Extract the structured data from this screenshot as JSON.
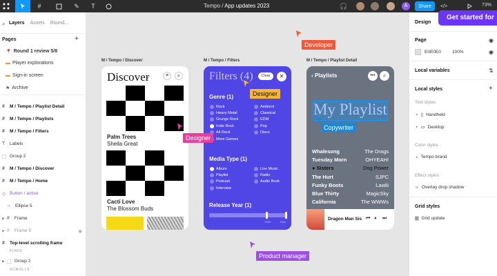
{
  "toolbar": {
    "file_path": "Tempo",
    "separator": "/",
    "file_name": "App updates 2023",
    "share_label": "Share",
    "avatar_letter": "A",
    "zoom": "73%",
    "code_label": "</>"
  },
  "promo": {
    "label": "Get started for"
  },
  "left_panel": {
    "tabs": [
      "Layers",
      "Assets",
      "Round..."
    ],
    "pages_title": "Pages",
    "pages": [
      "Round 1 review 5/8",
      "Player explorations",
      "Sign-in screen",
      "Archive"
    ],
    "layers": [
      "M / Tempo / Playlist Detail",
      "M / Tempo / Playlists",
      "M / Tempo / Filters",
      "Labels",
      "Group 2",
      "M / Tempo / Discover",
      "M / Tempo / Home",
      "Button / active",
      "Ellipse 5",
      "Frame",
      "Frame 5",
      "Top-level scrolling frame",
      "Group 2"
    ],
    "fixed_label": "FIXED",
    "scrolls_label": "SCROLLS"
  },
  "frames": {
    "discover": {
      "label": "M / Tempo / Discover",
      "title": "Discover",
      "track1_title": "Palm Trees",
      "track1_artist": "Sheila Great",
      "track2_title": "Cacti Love",
      "track2_artist": "The Blossom Buds"
    },
    "filters": {
      "label": "M / Tempo / Filters",
      "title": "Filters (4)",
      "clear": "Clear",
      "genre_title": "Genre (1)",
      "genres_left": [
        "Rock",
        "Heavy Metal",
        "Grunge Rock",
        "Indie Rock",
        "Alt Rock",
        "More Genres"
      ],
      "genres_right": [
        "Ambient",
        "Classical",
        "EDM",
        "Pop",
        "Disco"
      ],
      "media_title": "Media Type (1)",
      "media_left": [
        "Album",
        "Playlist",
        "Podcast",
        "Interview"
      ],
      "media_right": [
        "Live Music",
        "Radio",
        "Audio Book"
      ],
      "year_title": "Release Year (1)",
      "year_min": "1990",
      "year_max": "Now"
    },
    "playlist": {
      "label": "M / Tempo / Playlist Detail",
      "header": "Playlists",
      "title": "My Playlist",
      "rows": [
        {
          "song": "Whalesong",
          "artist": "The Drags"
        },
        {
          "song": "Tuesday Morn",
          "artist": "OHYEAH!"
        },
        {
          "song": "Sisters",
          "artist": "Dog Power"
        },
        {
          "song": "The Hurt",
          "artist": "SJPC"
        },
        {
          "song": "Funky Boots",
          "artist": "Lawlii"
        },
        {
          "song": "Blue Thirty",
          "artist": "MagicSky"
        },
        {
          "song": "California",
          "artist": "The WWWs"
        }
      ],
      "now_playing": "Dragon Man Sis"
    }
  },
  "cursors": {
    "developer": "Developer",
    "designer1": "Designer",
    "designer2": "Designer",
    "copywriter": "Copywriter",
    "pm": "Product manager"
  },
  "right_panel": {
    "tab": "Design",
    "page_title": "Page",
    "page_color": "E0E0E0",
    "page_opacity": "100%",
    "local_variables": "Local variables",
    "local_styles": "Local styles",
    "text_styles": "Text styles",
    "text_items": [
      "Handheld",
      "Desktop"
    ],
    "color_styles": "Color styles",
    "color_items": [
      "Tempo brand"
    ],
    "effect_styles": "Effect styles",
    "effect_items": [
      "Overlay drop shadow"
    ],
    "grid_styles": "Grid styles",
    "grid_items": [
      "Grid update"
    ]
  },
  "colors": {
    "accent": "#0d99ff",
    "filters_bg": "#5046e5",
    "playlist_bg": "#6b7280",
    "developer": "#ef5a3c",
    "designer": "#ffb627",
    "designer_pink": "#ec3ca0",
    "copywriter": "#1f86d6",
    "pm": "#9b51e0"
  }
}
